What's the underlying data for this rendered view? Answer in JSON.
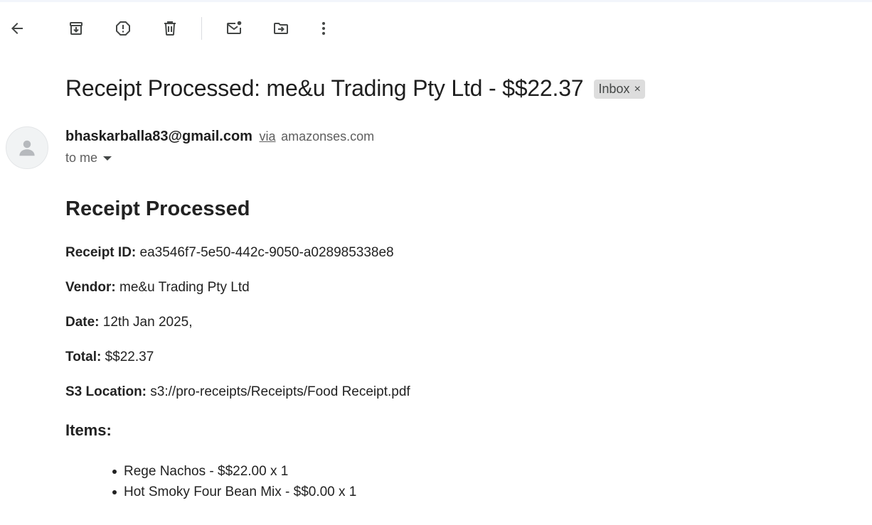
{
  "toolbar": {
    "icons": [
      "back-arrow-icon",
      "archive-icon",
      "report-spam-icon",
      "delete-icon",
      "mark-unread-icon",
      "move-to-icon",
      "more-options-icon"
    ]
  },
  "email": {
    "subject": "Receipt Processed: me&u Trading Pty Ltd - $$22.37",
    "label": "Inbox",
    "label_close": "×",
    "sender": "bhaskarballa83@gmail.com",
    "via_text": "via",
    "via_domain": "amazonses.com",
    "to": "to me"
  },
  "content": {
    "heading": "Receipt Processed",
    "fields": [
      {
        "label": "Receipt ID:",
        "value": "ea3546f7-5e50-442c-9050-a028985338e8"
      },
      {
        "label": "Vendor:",
        "value": "me&u Trading Pty Ltd"
      },
      {
        "label": "Date:",
        "value": "12th Jan 2025,"
      },
      {
        "label": "Total:",
        "value": "$$22.37"
      },
      {
        "label": "S3 Location:",
        "value": "s3://pro-receipts/Receipts/Food Receipt.pdf"
      }
    ],
    "items_heading": "Items:",
    "items": [
      "Rege Nachos - $$22.00 x 1",
      "Hot Smoky Four Bean Mix - $$0.00 x 1"
    ]
  },
  "colors": {
    "text": "#1f1f1f",
    "muted": "#5e5e5e",
    "chip_bg": "#dddddd",
    "icon": "#444746"
  }
}
